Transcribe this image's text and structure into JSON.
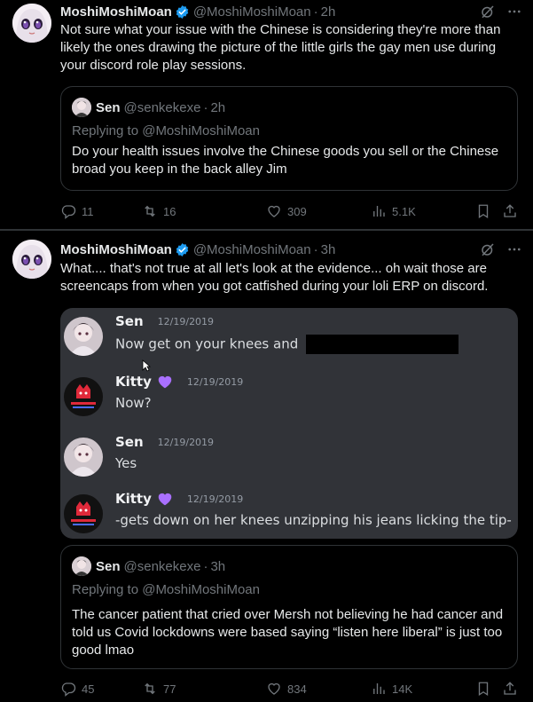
{
  "tweets": [
    {
      "author": {
        "name": "MoshiMoshiMoan",
        "handle": "@MoshiMoshiMoan",
        "time": "2h"
      },
      "text": "Not sure what your issue with the Chinese is considering they're more than likely the ones drawing the picture of the little girls the gay men use during your discord role play sessions.",
      "quote": {
        "name": "Sen",
        "handle": "@senkekexe",
        "time": "2h",
        "replying": "Replying to @MoshiMoshiMoan",
        "text": "Do your health issues involve the Chinese goods you sell or the Chinese broad you keep in the back alley Jim"
      },
      "stats": {
        "replies": "11",
        "reposts": "16",
        "likes": "309",
        "views": "5.1K"
      }
    },
    {
      "author": {
        "name": "MoshiMoshiMoan",
        "handle": "@MoshiMoshiMoan",
        "time": "3h"
      },
      "text": "What.... that's not true at all let's look at the evidence... oh wait those are screencaps from when you got catfished during your loli ERP on discord.",
      "discord": [
        {
          "name": "Sen",
          "timestamp": "12/19/2019",
          "text": "Now get on your knees and",
          "redacted": true,
          "heart": false
        },
        {
          "name": "Kitty",
          "timestamp": "12/19/2019",
          "text": "Now?",
          "redacted": false,
          "heart": true
        },
        {
          "name": "Sen",
          "timestamp": "12/19/2019",
          "text": "Yes",
          "redacted": false,
          "heart": false
        },
        {
          "name": "Kitty",
          "timestamp": "12/19/2019",
          "text": "-gets down on her knees unzipping his jeans licking the tip-",
          "redacted": false,
          "heart": true
        }
      ],
      "quote": {
        "name": "Sen",
        "handle": "@senkekexe",
        "time": "3h",
        "replying": "Replying to @MoshiMoshiMoan",
        "text": "The cancer patient that cried over Mersh not believing he had cancer and told us Covid lockdowns were based saying “listen here liberal” is just too good lmao"
      },
      "stats": {
        "replies": "45",
        "reposts": "77",
        "likes": "834",
        "views": "14K"
      }
    }
  ],
  "colors": {
    "background": "#000000",
    "text": "#e7e9ea",
    "secondary": "#71767b",
    "border": "#2f3336",
    "verified": "#1d9bf0",
    "discord_bg": "#313338",
    "heart": "#a970ff"
  }
}
